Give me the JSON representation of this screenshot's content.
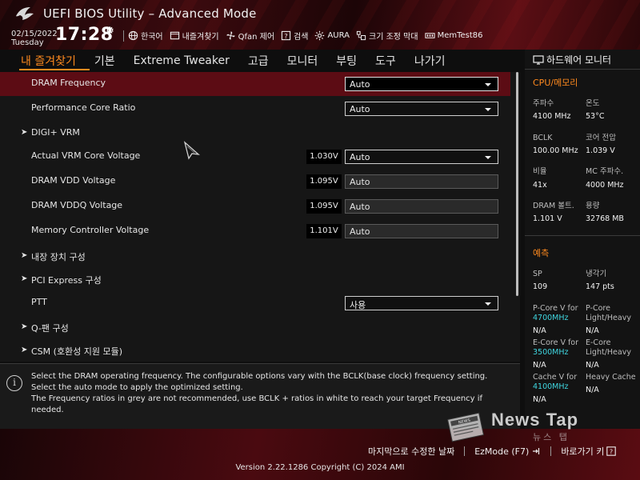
{
  "header": {
    "title": "UEFI BIOS Utility – Advanced Mode",
    "date": "02/15/2022",
    "day": "Tuesday",
    "time": "17:28",
    "toolbar": [
      {
        "label": "한국어",
        "icon": "globe-icon"
      },
      {
        "label": "내즐겨찾기",
        "icon": "favorites-icon"
      },
      {
        "label": "Qfan 제어",
        "icon": "fan-icon"
      },
      {
        "label": "검색",
        "icon": "search-icon"
      },
      {
        "label": "AURA",
        "icon": "aura-icon"
      },
      {
        "label": "크기 조정 막대",
        "icon": "resize-bar-icon"
      },
      {
        "label": "MemTest86",
        "icon": "memtest-icon"
      }
    ]
  },
  "tabs": [
    {
      "label": "내 즐겨찾기",
      "active": true
    },
    {
      "label": "기본",
      "active": false
    },
    {
      "label": "Extreme Tweaker",
      "active": false
    },
    {
      "label": "고급",
      "active": false
    },
    {
      "label": "모니터",
      "active": false
    },
    {
      "label": "부팅",
      "active": false
    },
    {
      "label": "도구",
      "active": false
    },
    {
      "label": "나가기",
      "active": false
    }
  ],
  "settings": [
    {
      "label": "DRAM Frequency",
      "type": "dropdown",
      "value": "Auto",
      "selected": true
    },
    {
      "label": "Performance Core Ratio",
      "type": "dropdown",
      "value": "Auto"
    },
    {
      "label": "DIGI+ VRM",
      "type": "submenu"
    },
    {
      "label": "Actual VRM Core Voltage",
      "type": "dropdown",
      "value": "Auto",
      "voltage": "1.030V"
    },
    {
      "label": "DRAM VDD Voltage",
      "type": "input",
      "value": "Auto",
      "voltage": "1.095V"
    },
    {
      "label": "DRAM VDDQ Voltage",
      "type": "input",
      "value": "Auto",
      "voltage": "1.095V"
    },
    {
      "label": "Memory Controller Voltage",
      "type": "input",
      "value": "Auto",
      "voltage": "1.101V"
    },
    {
      "label": "내장 장치 구성",
      "type": "submenu"
    },
    {
      "label": "PCI Express 구성",
      "type": "submenu"
    },
    {
      "label": "PTT",
      "type": "dropdown",
      "value": "사용"
    },
    {
      "label": "Q-팬 구성",
      "type": "submenu"
    },
    {
      "label": "CSM (호환성 지원 모듈)",
      "type": "submenu"
    }
  ],
  "help": {
    "line1": "Select the DRAM operating frequency. The configurable options vary with the BCLK(base clock) frequency setting. Select the auto mode to apply the optimized setting.",
    "line2": "The Frequency ratios in grey are not recommended, use BCLK + ratios in white to reach your target Frequency if needed."
  },
  "hw_monitor": {
    "title": "하드웨어 모니터",
    "cpu_section": "CPU/메모리",
    "freq_label": "주파수",
    "freq_value": "4100 MHz",
    "temp_label": "온도",
    "temp_value": "53°C",
    "bclk_label": "BCLK",
    "bclk_value": "100.00 MHz",
    "core_v_label": "코어 전압",
    "core_v_value": "1.039 V",
    "ratio_label": "비율",
    "ratio_value": "41x",
    "mc_freq_label": "MC 주파수.",
    "mc_freq_value": "4000 MHz",
    "dram_v_label": "DRAM 볼트.",
    "dram_v_value": "1.101 V",
    "capacity_label": "용량",
    "capacity_value": "32768 MB",
    "predict_section": "예측",
    "sp_label": "SP",
    "sp_value": "109",
    "cooler_label": "냉각기",
    "cooler_value": "147 pts",
    "pcore_label": "P-Core V for",
    "pcore_freq": "4700MHz",
    "pcore_value": "N/A",
    "pcore_lh_label1": "P-Core",
    "pcore_lh_label2": "Light/Heavy",
    "pcore_lh_value": "N/A",
    "ecore_label": "E-Core V for",
    "ecore_freq": "3500MHz",
    "ecore_value": "N/A",
    "ecore_lh_label1": "E-Core",
    "ecore_lh_label2": "Light/Heavy",
    "ecore_lh_value": "N/A",
    "cache_label": "Cache V for",
    "cache_freq": "4100MHz",
    "cache_value": "N/A",
    "heavy_cache_label": "Heavy Cache",
    "heavy_cache_value": "N/A"
  },
  "watermark": {
    "text": "News Tap",
    "sub": "뉴스 탭"
  },
  "footer": {
    "last_modified": "마지막으로 수정한 날짜",
    "ezmode": "EzMode (F7)",
    "hotkeys": "바로가기 키",
    "version": "Version 2.22.1286 Copyright (C) 2024 AMI"
  },
  "colors": {
    "accent": "#ff8a1e",
    "selected_row": "#5c0c14",
    "freq_highlight": "#3fd6e0"
  }
}
